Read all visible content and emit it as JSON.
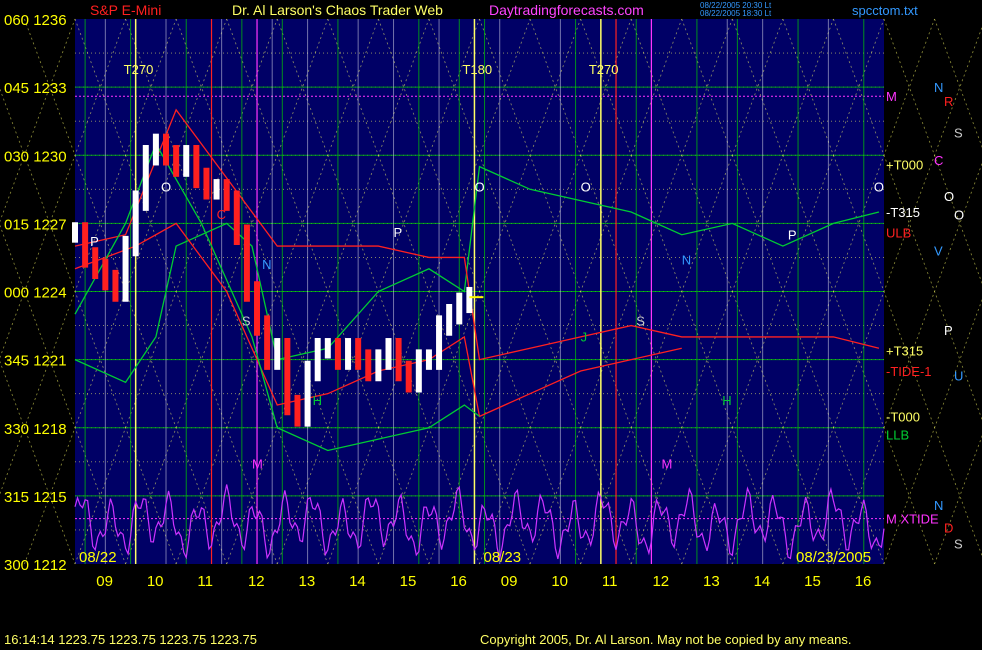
{
  "header": {
    "symbol": "S&P E-Mini",
    "title": "Dr. Al Larson's Chaos Trader Web",
    "site": "Daytradingforecasts.com",
    "stamp1": "08/22/2005 20:30 Lt",
    "stamp2": "08/22/2005 18:30 Lt",
    "file": "spcctom.txt"
  },
  "footer": {
    "quote": "16:14:14  1223.75 1223.75 1223.75 1223.75",
    "copyright": "Copyright 2005, Dr. Al Larson. May not be copied by any means."
  },
  "colors": {
    "panel": "#000066",
    "axis_text": "#ffff00",
    "grid_green": "#00cc00",
    "grid_yellow": "#ffff66",
    "price_up": "#ffffff",
    "price_down": "#ff2020",
    "title_text": "#ffff66",
    "site_text": "#ff44ff",
    "symbol_text": "#ff2020",
    "file_text": "#3399ff",
    "magenta_line": "#ff33ff"
  },
  "chart_data": {
    "type": "line",
    "y_axis": {
      "min": 1212,
      "max": 1236,
      "ticks": [
        {
          "price": 1236,
          "label": "060 1236"
        },
        {
          "price": 1233,
          "label": "045 1233"
        },
        {
          "price": 1230,
          "label": "030 1230"
        },
        {
          "price": 1227,
          "label": "015 1227"
        },
        {
          "price": 1224,
          "label": "000 1224"
        },
        {
          "price": 1221,
          "label": "345 1221"
        },
        {
          "price": 1218,
          "label": "330 1218"
        },
        {
          "price": 1215,
          "label": "315 1215"
        },
        {
          "price": 1212,
          "label": "300 1212"
        }
      ]
    },
    "x_axis": {
      "hours_per_day": 7,
      "days": 2,
      "day0_start_hour": 9,
      "labels": [
        {
          "t": 0.5,
          "text": "09"
        },
        {
          "t": 1.5,
          "text": "10"
        },
        {
          "t": 2.5,
          "text": "11"
        },
        {
          "t": 3.5,
          "text": "12"
        },
        {
          "t": 4.5,
          "text": "13"
        },
        {
          "t": 5.5,
          "text": "14"
        },
        {
          "t": 6.5,
          "text": "15"
        },
        {
          "t": 7.5,
          "text": "16"
        },
        {
          "t": 8.5,
          "text": "09"
        },
        {
          "t": 9.5,
          "text": "10"
        },
        {
          "t": 10.5,
          "text": "11"
        },
        {
          "t": 11.5,
          "text": "12"
        },
        {
          "t": 12.5,
          "text": "13"
        },
        {
          "t": 13.5,
          "text": "14"
        },
        {
          "t": 14.5,
          "text": "15"
        },
        {
          "t": 15.5,
          "text": "16"
        }
      ],
      "dates": [
        {
          "t": 0,
          "text": "08/22"
        },
        {
          "t": 8,
          "text": "08/23"
        },
        {
          "t": 16,
          "text": "08/23/2005"
        }
      ]
    },
    "price_series": {
      "name": "S&P E-Mini",
      "t": [
        0.0,
        0.2,
        0.4,
        0.6,
        0.8,
        1.0,
        1.2,
        1.4,
        1.6,
        1.8,
        2.0,
        2.2,
        2.4,
        2.6,
        2.8,
        3.0,
        3.2,
        3.4,
        3.6,
        3.8,
        4.0,
        4.2,
        4.4,
        4.6,
        4.8,
        5.0,
        5.2,
        5.4,
        5.6,
        5.8,
        6.0,
        6.2,
        6.4,
        6.6,
        6.8,
        7.0,
        7.2,
        7.4,
        7.6,
        7.8
      ],
      "close": [
        1226.6,
        1225.5,
        1225.0,
        1224.5,
        1224.0,
        1226.0,
        1228.0,
        1230.0,
        1230.5,
        1230.0,
        1229.5,
        1230.0,
        1229.0,
        1228.5,
        1228.5,
        1228.0,
        1226.5,
        1224.0,
        1222.5,
        1221.0,
        1221.5,
        1219.0,
        1218.5,
        1220.5,
        1221.5,
        1221.5,
        1221.0,
        1221.5,
        1221.0,
        1220.5,
        1221.0,
        1221.5,
        1220.5,
        1220.0,
        1221.0,
        1221.0,
        1222.5,
        1223.0,
        1223.5,
        1223.75
      ]
    },
    "overlay_series": [
      {
        "color": "#00cc33",
        "t": [
          0,
          1,
          1.6,
          2,
          3,
          3.5,
          4,
          5,
          6,
          7,
          7.7,
          8,
          9,
          10,
          11,
          12,
          13,
          14,
          15,
          15.9
        ],
        "y": [
          1221,
          1220,
          1222,
          1226,
          1227,
          1226,
          1221,
          1221.5,
          1224,
          1225,
          1224,
          1229.5,
          1228.5,
          1228,
          1227.5,
          1226.5,
          1227,
          1226,
          1227,
          1227.5
        ]
      },
      {
        "color": "#ff2020",
        "t": [
          0,
          1,
          2,
          3,
          4,
          5,
          6,
          7,
          7.7,
          8,
          9,
          10,
          11,
          12,
          13,
          14,
          15,
          15.9
        ],
        "y": [
          1226,
          1226.5,
          1232,
          1229,
          1226,
          1226,
          1226,
          1225.5,
          1225.5,
          1221,
          1221.5,
          1222,
          1222.5,
          1222,
          1222,
          1222,
          1222,
          1221.5
        ]
      },
      {
        "color": "#ff2020",
        "t": [
          0,
          1.2,
          2,
          3,
          4,
          5,
          6,
          7,
          7.7,
          8,
          9,
          10,
          11,
          12
        ],
        "y": [
          1225,
          1226,
          1227,
          1224,
          1219,
          1219.5,
          1220.5,
          1221,
          1222,
          1218.5,
          1219.5,
          1220.5,
          1221,
          1221.5
        ]
      },
      {
        "color": "#00cc33",
        "t": [
          0,
          1,
          1.6,
          2.5,
          3.5,
          4,
          5,
          6,
          7,
          7.7,
          8
        ],
        "y": [
          1223,
          1227,
          1230.5,
          1227,
          1222,
          1218,
          1217,
          1217.5,
          1218,
          1219,
          1218.5
        ]
      }
    ],
    "bottom_oscillator_color": "#cc33ff",
    "vertical_markers": [
      {
        "t": 1.2,
        "label": "T270"
      },
      {
        "t": 7.9,
        "label": "T180"
      },
      {
        "t": 10.4,
        "label": "T270"
      }
    ],
    "right_labels": [
      {
        "price": 1232.6,
        "text": "M",
        "color": "#ff33ff"
      },
      {
        "price": 1229.6,
        "text": "+T000",
        "color": "#ffff66"
      },
      {
        "price": 1227.5,
        "text": "-T315",
        "color": "#ffffff"
      },
      {
        "price": 1226.6,
        "text": "ULB",
        "color": "#ff2020"
      },
      {
        "price": 1221.4,
        "text": "+T315",
        "color": "#ffff66"
      },
      {
        "price": 1220.5,
        "text": "-TIDE-1",
        "color": "#ff2020"
      },
      {
        "price": 1218.5,
        "text": "-T000",
        "color": "#ffff66"
      },
      {
        "price": 1217.7,
        "text": "LLB",
        "color": "#00cc33"
      },
      {
        "price": 1214.0,
        "text": "M XTIDE",
        "color": "#ff33ff"
      }
    ],
    "far_right_letters": [
      {
        "price": 1233.0,
        "text": "N",
        "color": "#3399ff"
      },
      {
        "price": 1232.4,
        "text": "R",
        "color": "#ff2020"
      },
      {
        "price": 1231.0,
        "text": "S",
        "color": "#cccccc"
      },
      {
        "price": 1229.8,
        "text": "C",
        "color": "#ff33ff"
      },
      {
        "price": 1228.2,
        "text": "O",
        "color": "#ffffff"
      },
      {
        "price": 1227.4,
        "text": "O",
        "color": "#ffffff"
      },
      {
        "price": 1225.8,
        "text": "V",
        "color": "#3399ff"
      },
      {
        "price": 1222.3,
        "text": "P",
        "color": "#ffffff"
      },
      {
        "price": 1220.3,
        "text": "U",
        "color": "#3399ff"
      },
      {
        "price": 1214.6,
        "text": "N",
        "color": "#3399ff"
      },
      {
        "price": 1213.6,
        "text": "D",
        "color": "#ff2020"
      },
      {
        "price": 1212.9,
        "text": "S",
        "color": "#cccccc"
      }
    ],
    "chart_letters": [
      {
        "t": 0.3,
        "price": 1226.0,
        "text": "P",
        "color": "#ffffff"
      },
      {
        "t": 1.7,
        "price": 1228.4,
        "text": "O",
        "color": "#ffffff"
      },
      {
        "t": 2.8,
        "price": 1227.2,
        "text": "C",
        "color": "#ff2020"
      },
      {
        "t": 3.7,
        "price": 1225.0,
        "text": "N",
        "color": "#3399ff"
      },
      {
        "t": 3.3,
        "price": 1222.5,
        "text": "S",
        "color": "#cccccc"
      },
      {
        "t": 4.7,
        "price": 1219.0,
        "text": "H",
        "color": "#00cc33"
      },
      {
        "t": 3.5,
        "price": 1216.2,
        "text": "M",
        "color": "#ff33ff"
      },
      {
        "t": 6.3,
        "price": 1226.4,
        "text": "P",
        "color": "#ffffff"
      },
      {
        "t": 7.9,
        "price": 1228.4,
        "text": "O",
        "color": "#ffffff"
      },
      {
        "t": 10.0,
        "price": 1228.4,
        "text": "O",
        "color": "#ffffff"
      },
      {
        "t": 12.0,
        "price": 1225.2,
        "text": "N",
        "color": "#3399ff"
      },
      {
        "t": 11.1,
        "price": 1222.5,
        "text": "S",
        "color": "#cccccc"
      },
      {
        "t": 10.0,
        "price": 1221.8,
        "text": "J",
        "color": "#00cc33"
      },
      {
        "t": 12.8,
        "price": 1219.0,
        "text": "H",
        "color": "#00cc33"
      },
      {
        "t": 11.6,
        "price": 1216.2,
        "text": "M",
        "color": "#ff33ff"
      },
      {
        "t": 14.1,
        "price": 1226.3,
        "text": "P",
        "color": "#ffffff"
      },
      {
        "t": 15.8,
        "price": 1228.4,
        "text": "O",
        "color": "#ffffff"
      }
    ]
  }
}
